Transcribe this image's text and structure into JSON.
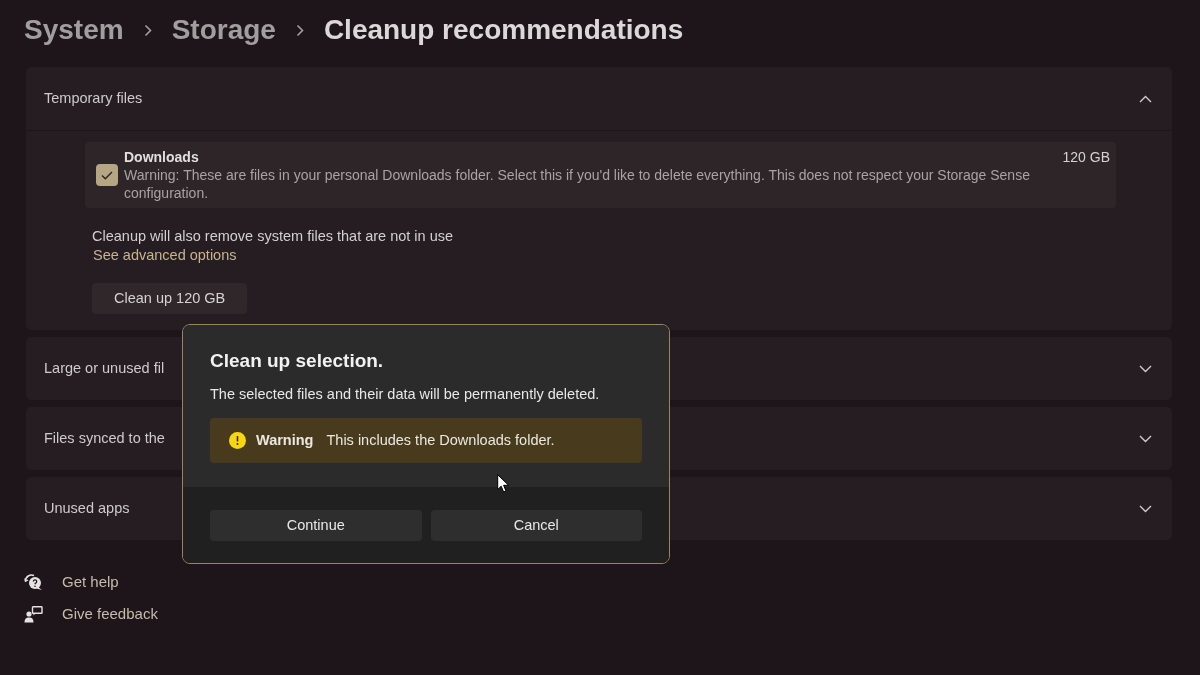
{
  "breadcrumb": {
    "path": [
      "System",
      "Storage"
    ],
    "current": "Cleanup recommendations"
  },
  "sections": [
    {
      "title": "Temporary files",
      "expanded": true,
      "items": [
        {
          "name": "Downloads",
          "size": "120 GB",
          "description": "Warning: These are files in your personal Downloads folder. Select this if you'd like to delete everything. This does not respect your Storage Sense configuration.",
          "checked": true
        }
      ],
      "note": "Cleanup will also remove system files that are not in use",
      "link": "See advanced options",
      "button": "Clean up 120 GB"
    },
    {
      "title": "Large or unused fil",
      "expanded": false
    },
    {
      "title": "Files synced to the",
      "expanded": false
    },
    {
      "title": "Unused apps",
      "expanded": false
    }
  ],
  "dialog": {
    "title": "Clean up selection.",
    "message": "The selected files and their data will be permanently deleted.",
    "warning": {
      "label": "Warning",
      "text": "This includes the Downloads folder."
    },
    "buttons": [
      "Continue",
      "Cancel"
    ]
  },
  "footer_links": [
    {
      "kind": "help",
      "label": "Get help"
    },
    {
      "kind": "feedback",
      "label": "Give feedback"
    }
  ]
}
